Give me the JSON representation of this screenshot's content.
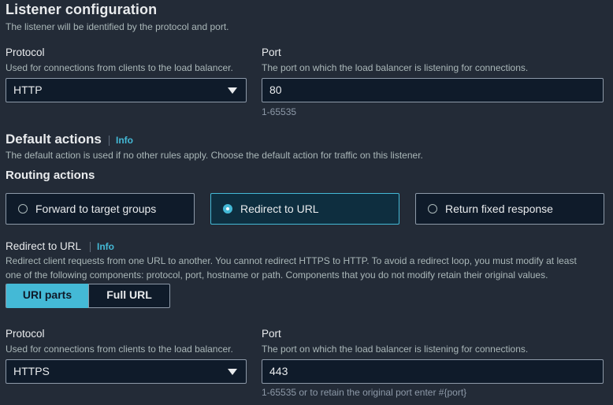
{
  "listener": {
    "title": "Listener configuration",
    "description": "The listener will be identified by the protocol and port.",
    "protocol": {
      "label": "Protocol",
      "description": "Used for connections from clients to the load balancer.",
      "value": "HTTP"
    },
    "port": {
      "label": "Port",
      "description": "The port on which the load balancer is listening for connections.",
      "value": "80",
      "hint": "1-65535"
    }
  },
  "default_actions": {
    "title": "Default actions",
    "info": "Info",
    "description": "The default action is used if no other rules apply. Choose the default action for traffic on this listener.",
    "routing_title": "Routing actions",
    "options": [
      {
        "label": "Forward to target groups",
        "selected": false
      },
      {
        "label": "Redirect to URL",
        "selected": true
      },
      {
        "label": "Return fixed response",
        "selected": false
      }
    ]
  },
  "redirect": {
    "title": "Redirect to URL",
    "info": "Info",
    "description_line1": "Redirect client requests from one URL to another. You cannot redirect HTTPS to HTTP. To avoid a redirect loop, you must modify at least",
    "description_line2": "one of the following components: protocol, port, hostname or path. Components that you do not modify retain their original values.",
    "segments": [
      "URI parts",
      "Full URL"
    ],
    "selected_segment": "URI parts",
    "protocol": {
      "label": "Protocol",
      "description": "Used for connections from clients to the load balancer.",
      "value": "HTTPS"
    },
    "port": {
      "label": "Port",
      "description": "The port on which the load balancer is listening for connections.",
      "value": "443",
      "hint": "1-65535 or to retain the original port enter #{port}"
    }
  },
  "colors": {
    "background": "#232b37",
    "accent": "#44b9d6",
    "field_background": "#0f1b2a",
    "selected_tile": "#0e2e3f"
  }
}
